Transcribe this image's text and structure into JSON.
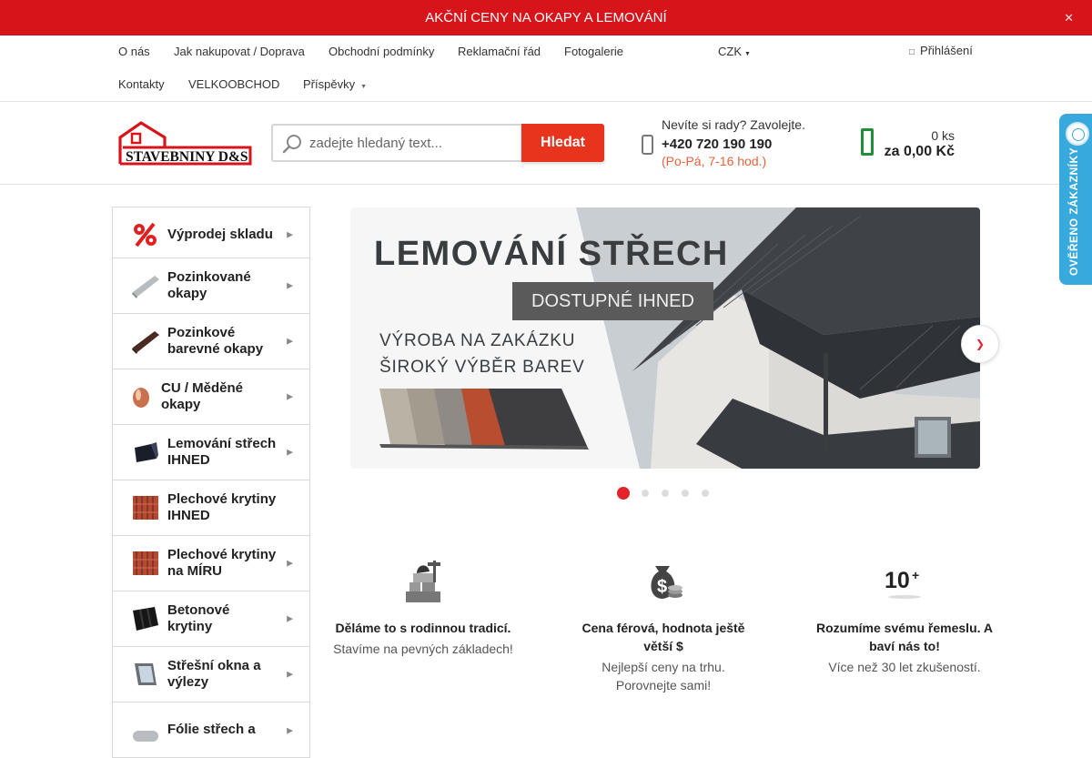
{
  "promo": {
    "text": "AKČNÍ CENY NA OKAPY A LEMOVÁNÍ",
    "close": ""
  },
  "topnav": {
    "row1": [
      "O nás",
      "Jak nakupovat / Doprava",
      "Obchodní podmínky",
      "Reklamační řád",
      "Fotogalerie"
    ],
    "row2": [
      "Kontakty",
      "VELKOOBCHOD",
      "Příspěvky"
    ],
    "currency": "CZK",
    "login": "Přihlášení"
  },
  "header": {
    "logo_text": "STAVEBNINY D&S",
    "search": {
      "placeholder": "zadejte hledaný text...",
      "button": "Hledat"
    },
    "contact": {
      "question": "Nevíte si rady? Zavolejte.",
      "phone": "+420 720 190 190",
      "hours": "(Po-Pá, 7-16 hod.)"
    },
    "cart": {
      "count": "0 ks",
      "total": "za 0,00 Kč"
    }
  },
  "review_badge": {
    "label": "OVĚŘENO ZÁKAZNÍKY"
  },
  "sidebar": {
    "categories": [
      {
        "label": "Výprodej skladu",
        "has_arrow": true
      },
      {
        "label": "Pozinkované okapy",
        "has_arrow": true
      },
      {
        "label": "Pozinkové barevné okapy",
        "has_arrow": true
      },
      {
        "label": "CU / Měděné okapy",
        "has_arrow": true
      },
      {
        "label": "Lemování střech IHNED",
        "has_arrow": true
      },
      {
        "label": "Plechové krytiny IHNED",
        "has_arrow": false
      },
      {
        "label": "Plechové krytiny na MÍRU",
        "has_arrow": true
      },
      {
        "label": "Betonové krytiny",
        "has_arrow": true
      },
      {
        "label": "Střešní okna a výlezy",
        "has_arrow": true
      },
      {
        "label": "Fólie střech a",
        "has_arrow": true
      }
    ]
  },
  "banner": {
    "headline": "LEMOVÁNÍ STŘECH",
    "tag": "DOSTUPNÉ IHNED",
    "line1": "VÝROBA NA ZAKÁZKU",
    "line2": "ŠIROKÝ VÝBĚR BAREV",
    "slides": 5,
    "active_slide": 1
  },
  "features": [
    {
      "icon": "family-tradition-icon",
      "title": "Děláme to s rodinnou tradicí.",
      "desc": "Stavíme na pevných základech!"
    },
    {
      "icon": "money-bag-icon",
      "title": "Cena férová, hodnota ještě větší $",
      "desc": "Nejlepší ceny na trhu. Porovnejte sami!"
    },
    {
      "icon": "ten-plus-icon",
      "title": "Rozumíme svému řemeslu. A baví nás to!",
      "desc": "Více než 30 let zkušeností."
    }
  ],
  "colors": {
    "brand_red": "#d7141a",
    "button_orange": "#e8341c",
    "cart_green": "#1f8f3a",
    "badge_blue": "#38a9dd"
  }
}
